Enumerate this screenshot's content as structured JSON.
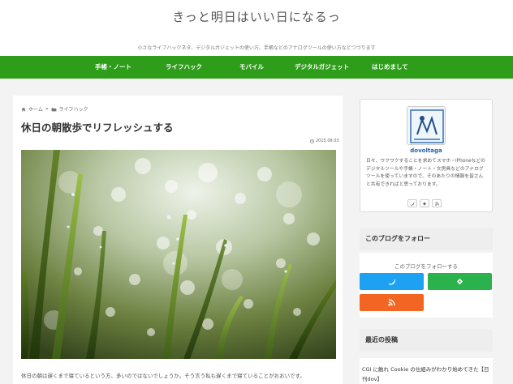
{
  "header": {
    "site_title": "きっと明日はいい日になるっ",
    "tagline": "小さなライフハックネタ、デジタルガジェットの使い方、手帳などのアナログツールの使い方などつづります"
  },
  "nav": {
    "items": [
      {
        "label": "手帳・ノート"
      },
      {
        "label": "ライフハック"
      },
      {
        "label": "モバイル"
      },
      {
        "label": "デジタルガジェット"
      },
      {
        "label": "はじめまして"
      }
    ]
  },
  "breadcrumb": {
    "home": "ホーム",
    "separator": "»",
    "category": "ライフハック"
  },
  "post": {
    "title": "休日の朝散歩でリフレッシュする",
    "date": "2015.08.03",
    "excerpt": "休日の朝は遅くまで寝ているという方、多いのではないでしょうか。そう言う私も遅くまで寝ていることがおおいです。"
  },
  "profile": {
    "name": "dovoltaga",
    "description": "日々、ワクワクすることを求めてスマホ・iPhoneなどのデジタルツールや手帳・ノート・文房具などのアナログツールを使っていますので、そのあたりの情報を皆さんと共有できればと思っております。",
    "icons": [
      "twitter-icon",
      "feedly-icon",
      "rss-icon"
    ]
  },
  "follow": {
    "heading": "このブログをフォロー",
    "caption": "このブログをフォローする",
    "colors": {
      "twitter": "#1da1f2",
      "feedly": "#2bb24c",
      "rss": "#f26522"
    }
  },
  "recent": {
    "heading": "最近の投稿",
    "first_post": "CGI に触れ Cookie の仕組みがわかり始めてきた【日刊dov】"
  },
  "colors": {
    "nav_bg": "#2e9e1a",
    "page_bg": "#f3f3f3",
    "link": "#2563a8"
  }
}
